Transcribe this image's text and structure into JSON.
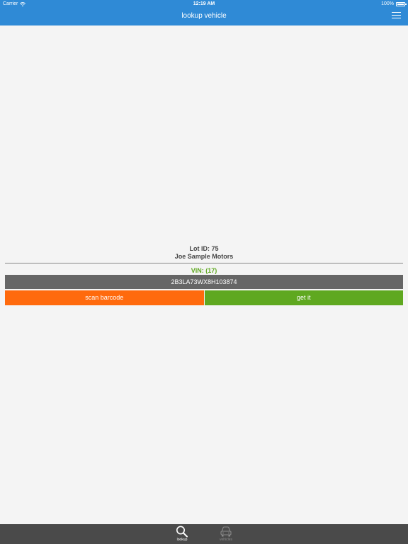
{
  "status_bar": {
    "carrier": "Carrier",
    "time": "12:19 AM",
    "battery": "100%"
  },
  "nav": {
    "title": "lookup vehicle"
  },
  "lot": {
    "id_text": "Lot ID: 75",
    "dealer_name": "Joe Sample Motors"
  },
  "vin": {
    "label": "VIN: (17)",
    "value": "2B3LA73WX8H103874"
  },
  "buttons": {
    "scan_label": "scan barcode",
    "get_label": "get it"
  },
  "tabbar": {
    "tabs": [
      {
        "label": "lookup",
        "icon": "search-icon",
        "selected": true
      },
      {
        "label": "vehicles",
        "icon": "car-icon",
        "selected": false
      }
    ]
  },
  "colors": {
    "nav_blue": "#2f8ad6",
    "scan_orange": "#ff6a0d",
    "get_green": "#5fa820",
    "vin_field": "#666666",
    "tabbar": "#4a4a4a"
  }
}
